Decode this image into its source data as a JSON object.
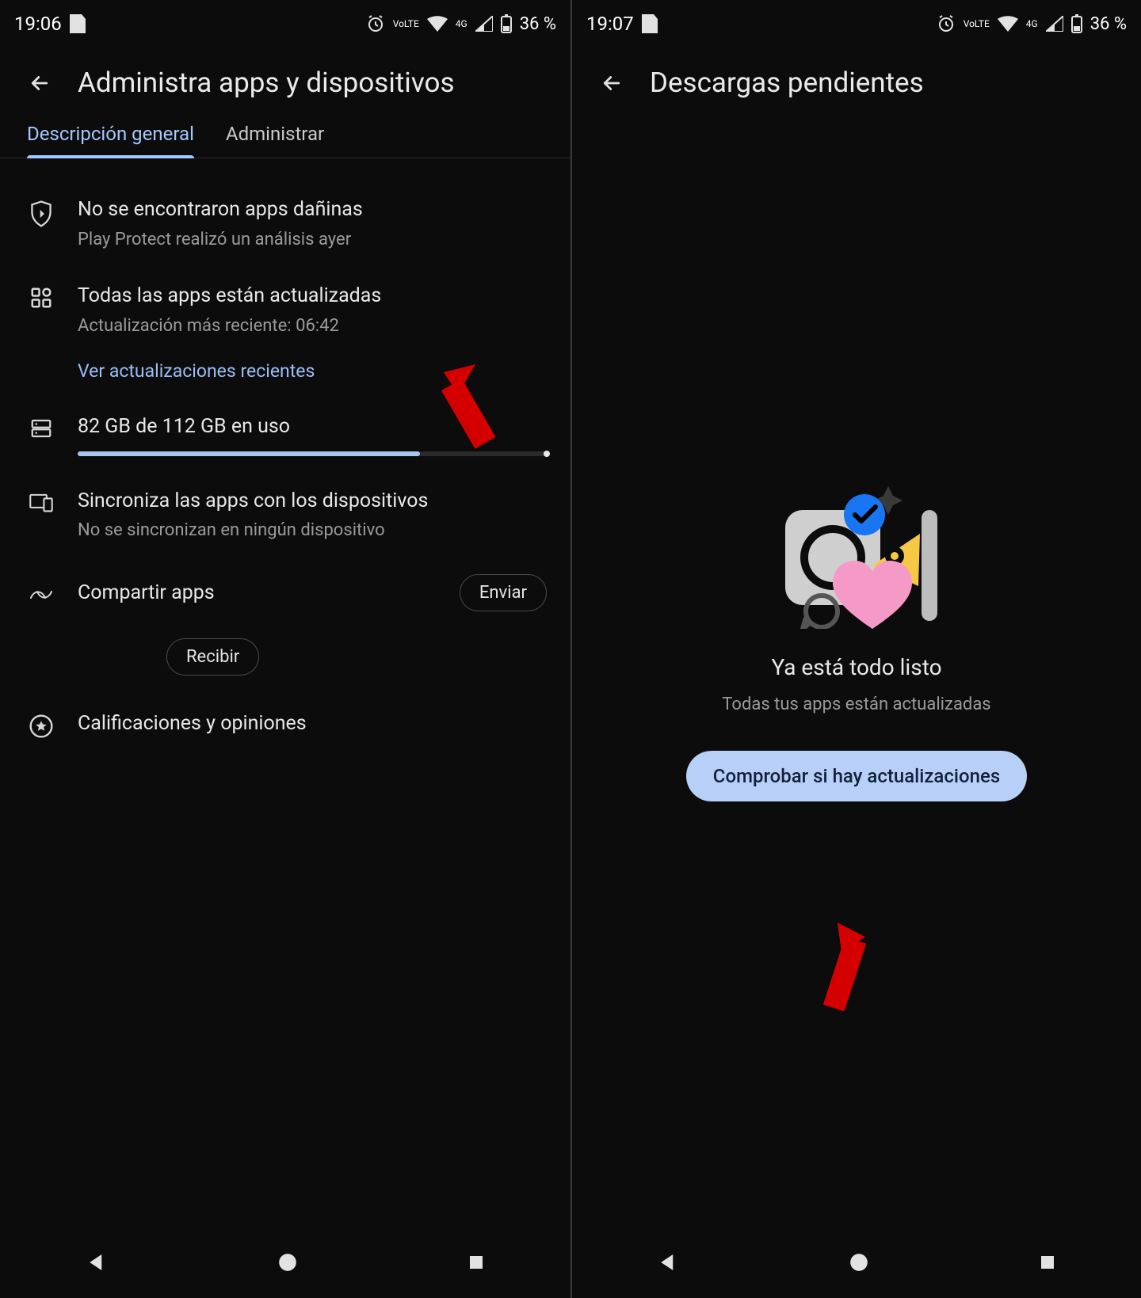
{
  "left": {
    "status": {
      "time": "19:06",
      "net": "4G",
      "battery": "36 %",
      "lte": "VoLTE"
    },
    "title": "Administra apps y dispositivos",
    "tabs": [
      {
        "label": "Descripción general",
        "active": true
      },
      {
        "label": "Administrar",
        "active": false
      }
    ],
    "protect": {
      "title": "No se encontraron apps dañinas",
      "sub": "Play Protect realizó un análisis ayer"
    },
    "updates": {
      "title": "Todas las apps están actualizadas",
      "sub": "Actualización más reciente: 06:42",
      "link": "Ver actualizaciones recientes"
    },
    "storage": {
      "title": "82 GB de 112 GB en uso",
      "percent": 73
    },
    "sync": {
      "title": "Sincroniza las apps con los dispositivos",
      "sub": "No se sincronizan en ningún dispositivo"
    },
    "share": {
      "label": "Compartir apps",
      "send": "Enviar",
      "receive": "Recibir"
    },
    "ratings": {
      "label": "Calificaciones y opiniones"
    }
  },
  "right": {
    "status": {
      "time": "19:07",
      "net": "4G",
      "battery": "36 %",
      "lte": "VoLTE"
    },
    "title": "Descargas pendientes",
    "empty": {
      "title": "Ya está todo listo",
      "sub": "Todas tus apps están actualizadas",
      "button": "Comprobar si hay actualizaciones"
    }
  }
}
